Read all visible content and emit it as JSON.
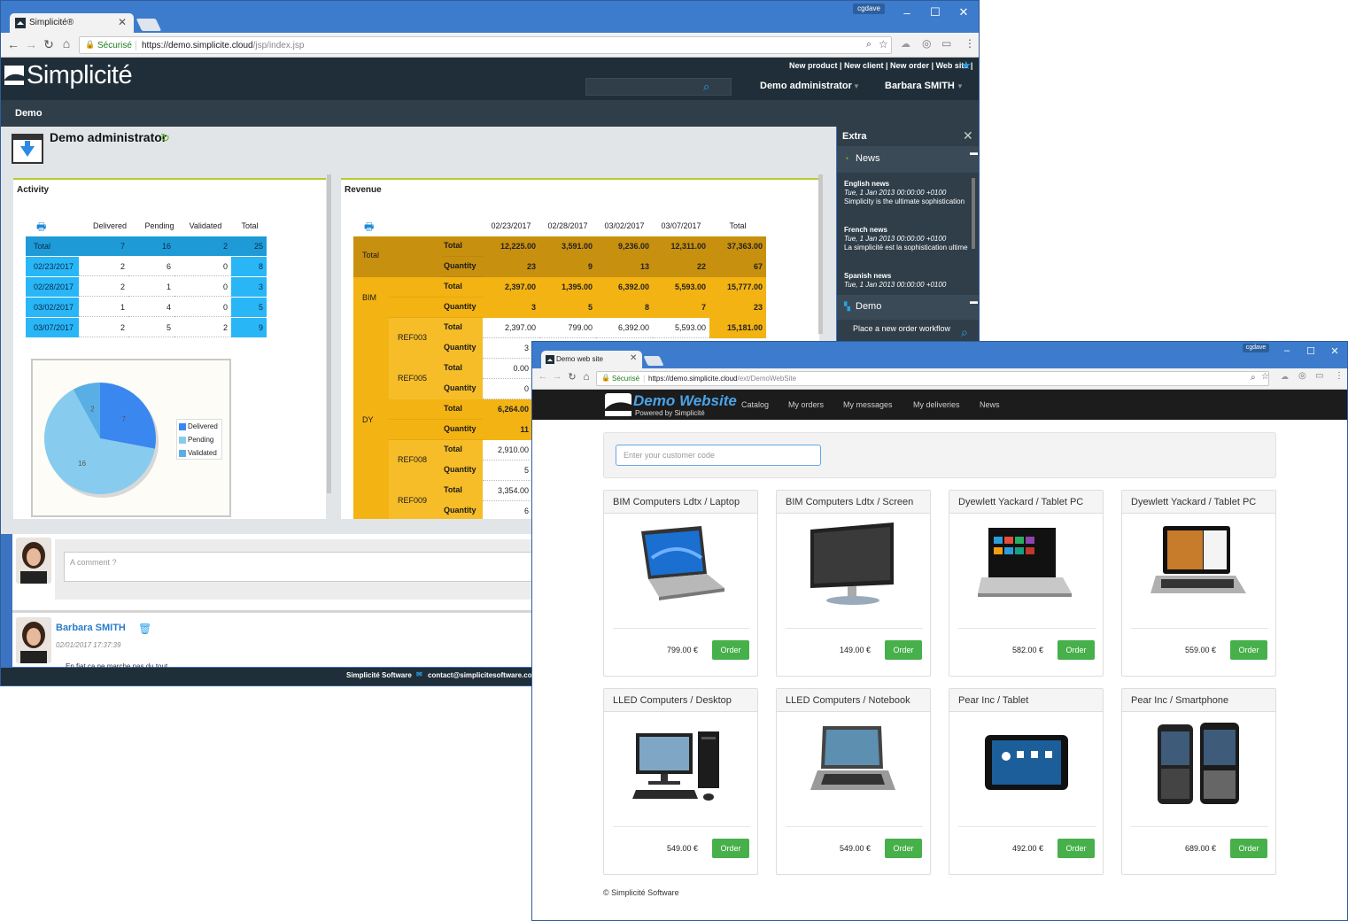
{
  "win1": {
    "tab_title": "Simplicité®",
    "user_chip": "cgdave",
    "secure_label": "Sécurisé",
    "url_host": "https://demo.simplicite.cloud",
    "url_path": "/jsp/index.jsp",
    "brand": "Simplicité",
    "top_links": "New product | New client | New order | Web site |",
    "header_user_role": "Demo administrator",
    "header_user_name": "Barbara SMITH",
    "breadcrumb": "Demo",
    "page_title": "Demo administrator",
    "activity": {
      "title": "Activity",
      "columns": [
        "Delivered",
        "Pending",
        "Validated",
        "Total"
      ],
      "total_row": {
        "label": "Total",
        "values": [
          "7",
          "16",
          "2",
          "25"
        ]
      },
      "rows": [
        {
          "label": "02/23/2017",
          "values": [
            "2",
            "6",
            "0",
            "8"
          ]
        },
        {
          "label": "02/28/2017",
          "values": [
            "2",
            "1",
            "0",
            "3"
          ]
        },
        {
          "label": "03/02/2017",
          "values": [
            "1",
            "4",
            "0",
            "5"
          ]
        },
        {
          "label": "03/07/2017",
          "values": [
            "2",
            "5",
            "2",
            "9"
          ]
        }
      ]
    },
    "pie": {
      "legend": [
        "Delivered",
        "Pending",
        "Validated"
      ],
      "labels": [
        "7",
        "16",
        "2"
      ],
      "values": [
        7,
        16,
        2
      ],
      "colors": [
        "#3a87f0",
        "#87ccee",
        "#5aaee6"
      ]
    },
    "revenue": {
      "title": "Revenue",
      "columns": [
        "02/23/2017",
        "02/28/2017",
        "03/02/2017",
        "03/07/2017",
        "Total"
      ],
      "total_total": [
        "12,225.00",
        "3,591.00",
        "9,236.00",
        "12,311.00",
        "37,363.00"
      ],
      "total_qty": [
        "23",
        "9",
        "13",
        "22",
        "67"
      ],
      "bim_total": [
        "2,397.00",
        "1,395.00",
        "6,392.00",
        "5,593.00",
        "15,777.00"
      ],
      "bim_qty": [
        "3",
        "5",
        "8",
        "7",
        "23"
      ],
      "ref003_total": [
        "2,397.00",
        "799.00",
        "6,392.00",
        "5,593.00",
        "15,181.00"
      ],
      "ref003_qty": "3",
      "ref005_total": "0.00",
      "ref005_qty": "0",
      "dy_total": "6,264.00",
      "dy_qty": "11",
      "ref008_total": "2,910.00",
      "ref008_qty": "5",
      "ref009_total": "3,354.00",
      "ref009_qty": "6",
      "group_labels": {
        "total": "Total",
        "bim": "BIM",
        "dy": "DY",
        "ref003": "REF003",
        "ref005": "REF005",
        "ref008": "REF008",
        "ref009": "REF009"
      },
      "measure_total": "Total",
      "measure_qty": "Quantity"
    },
    "extra": {
      "title": "Extra",
      "news_title": "News",
      "news": [
        {
          "title": "English news",
          "date": "Tue, 1 Jan 2013 00:00:00 +0100",
          "text": "Simplicity is the ultimate sophistication"
        },
        {
          "title": "French news",
          "date": "Tue, 1 Jan 2013 00:00:00 +0100",
          "text": "La simplicité est la sophistication ultime"
        },
        {
          "title": "Spanish news",
          "date": "Tue, 1 Jan 2013 00:00:00 +0100",
          "text": ""
        }
      ],
      "demo_title": "Demo",
      "workflow": "Place a new order workflow"
    },
    "comment_placeholder": "A comment ?",
    "post_author": "Barbara SMITH",
    "post_date": "02/01/2017 17:37:39",
    "post_text": "En fiat ca ne marche pas du tout",
    "footer_company": "Simplicité Software",
    "footer_email": "contact@simplicitesoftware.com"
  },
  "win2": {
    "tab_title": "Demo web site",
    "user_chip": "cgdave",
    "secure_label": "Sécurisé",
    "url_host": "https://demo.simplicite.cloud",
    "url_path": "/ext/DemoWebSite",
    "logo_title": "Demo Website",
    "logo_sub": "Powered by Simplicité",
    "nav": [
      "Catalog",
      "My orders",
      "My messages",
      "My deliveries",
      "News"
    ],
    "code_placeholder": "Enter your customer code",
    "order_label": "Order",
    "products": [
      {
        "title": "BIM Computers Ldtx / Laptop",
        "price": "799.00 €",
        "kind": "laptop"
      },
      {
        "title": "BIM Computers Ldtx / Screen",
        "price": "149.00 €",
        "kind": "screen"
      },
      {
        "title": "Dyewlett Yackard / Tablet PC",
        "price": "582.00 €",
        "kind": "tabletpc"
      },
      {
        "title": "Dyewlett Yackard / Tablet PC",
        "price": "559.00 €",
        "kind": "tabletpc2"
      },
      {
        "title": "LLED Computers / Desktop",
        "price": "549.00 €",
        "kind": "desktop"
      },
      {
        "title": "LLED Computers / Notebook",
        "price": "549.00 €",
        "kind": "notebook"
      },
      {
        "title": "Pear Inc / Tablet",
        "price": "492.00 €",
        "kind": "tablet"
      },
      {
        "title": "Pear Inc / Smartphone",
        "price": "689.00 €",
        "kind": "phone"
      }
    ],
    "copyright": "© Simplicité Software"
  }
}
